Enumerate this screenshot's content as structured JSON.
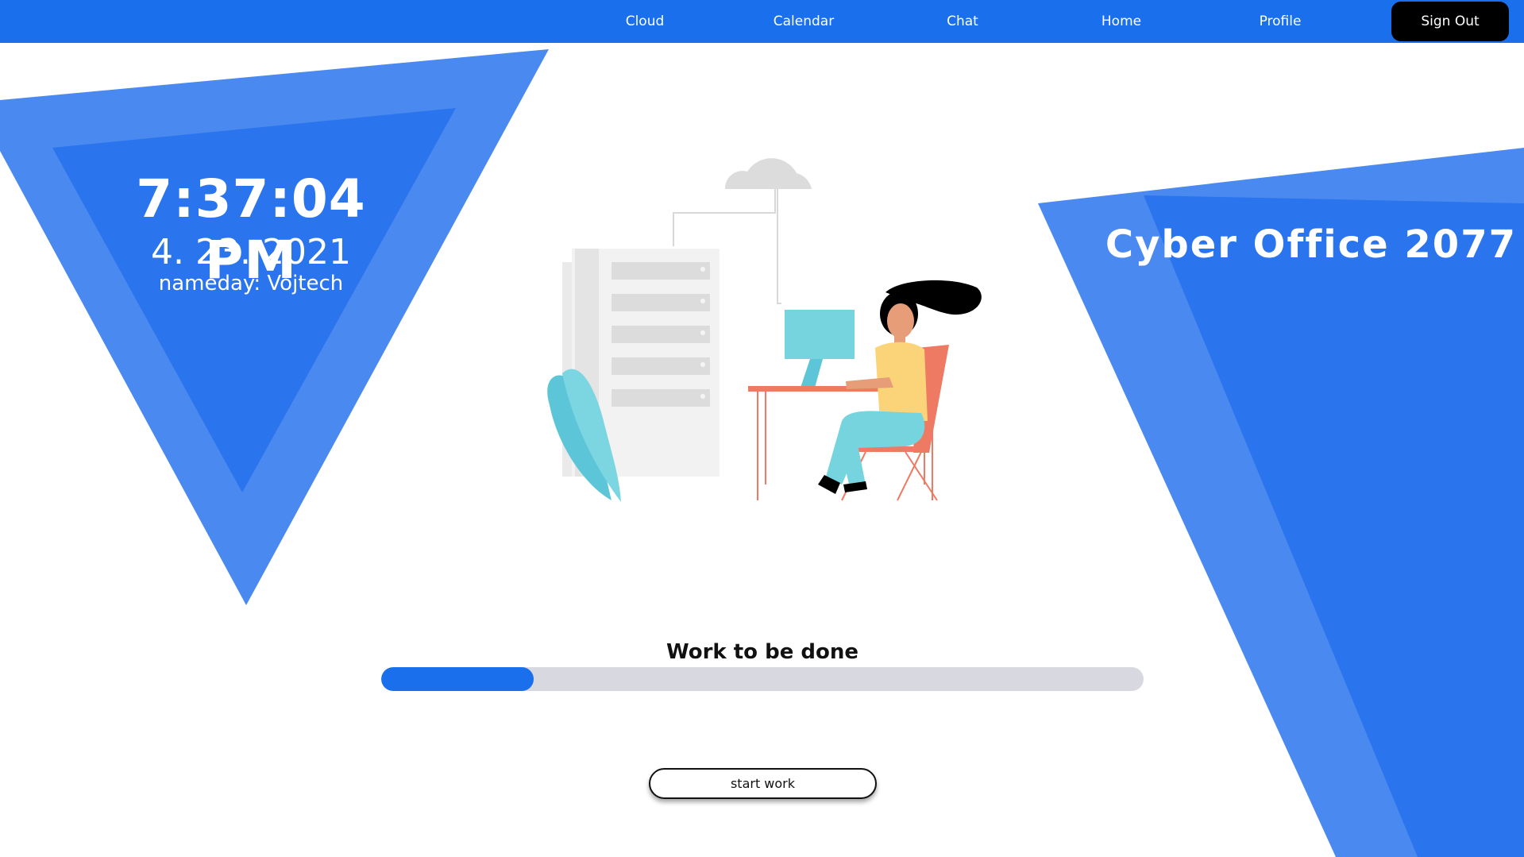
{
  "nav": {
    "items": [
      {
        "label": "Cloud"
      },
      {
        "label": "Calendar"
      },
      {
        "label": "Chat"
      },
      {
        "label": "Home"
      },
      {
        "label": "Profile"
      }
    ],
    "sign_out_label": "Sign Out"
  },
  "clock": {
    "time": "7:37:04 PM",
    "date": "4. 23. 2021",
    "nameday": "nameday: Vojtech"
  },
  "brand": {
    "title": "Cyber Office 2077"
  },
  "progress": {
    "label": "Work to be done",
    "value_fraction": 0.2
  },
  "start_button": {
    "label": "start work"
  },
  "colors": {
    "primary": "#1a6fec",
    "triangle_light": "#4a8af0",
    "triangle_dark": "#2a74ee",
    "track": "#d8d8e0",
    "sign_out_bg": "#000000"
  }
}
